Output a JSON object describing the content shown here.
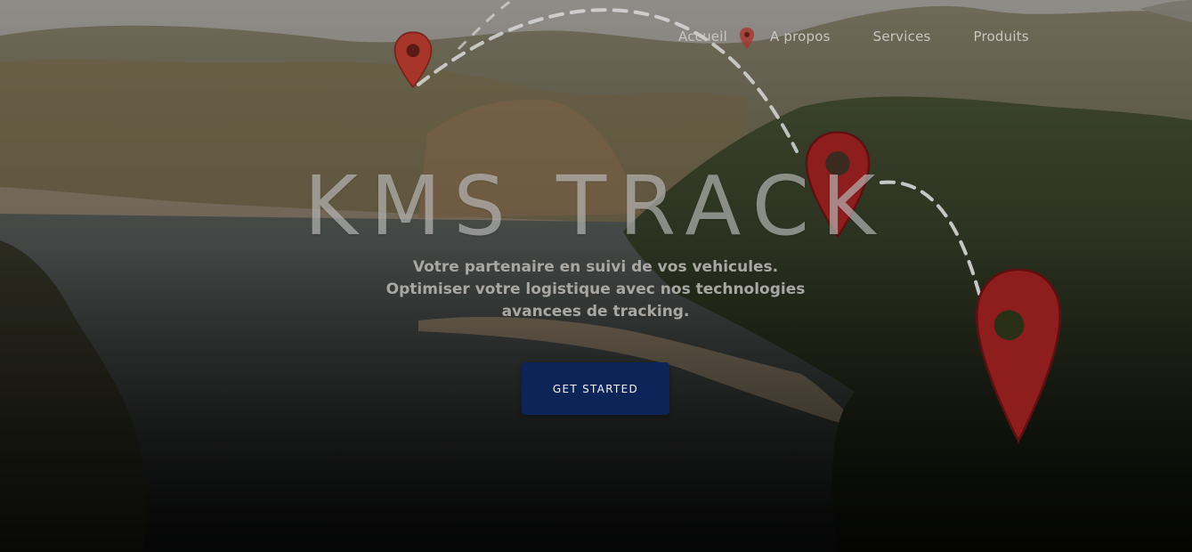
{
  "nav": {
    "items": [
      {
        "label": "Accueil"
      },
      {
        "label": "A propos"
      },
      {
        "label": "Services"
      },
      {
        "label": "Produits"
      }
    ]
  },
  "hero": {
    "title": "KMS TRACK",
    "subtitle": "Votre partenaire en suivi de vos vehicules. Optimiser votre logistique avec nos technologies avancees de tracking.",
    "cta_label": "GET STARTED"
  },
  "icons": {
    "pin": "map-pin-icon",
    "route": "dashed-route-line"
  },
  "colors": {
    "cta_background": "#0d2458",
    "pin_red": "#8e1d1d",
    "nav_text": "#c9c6c0",
    "route_line": "#d8d8d8"
  }
}
